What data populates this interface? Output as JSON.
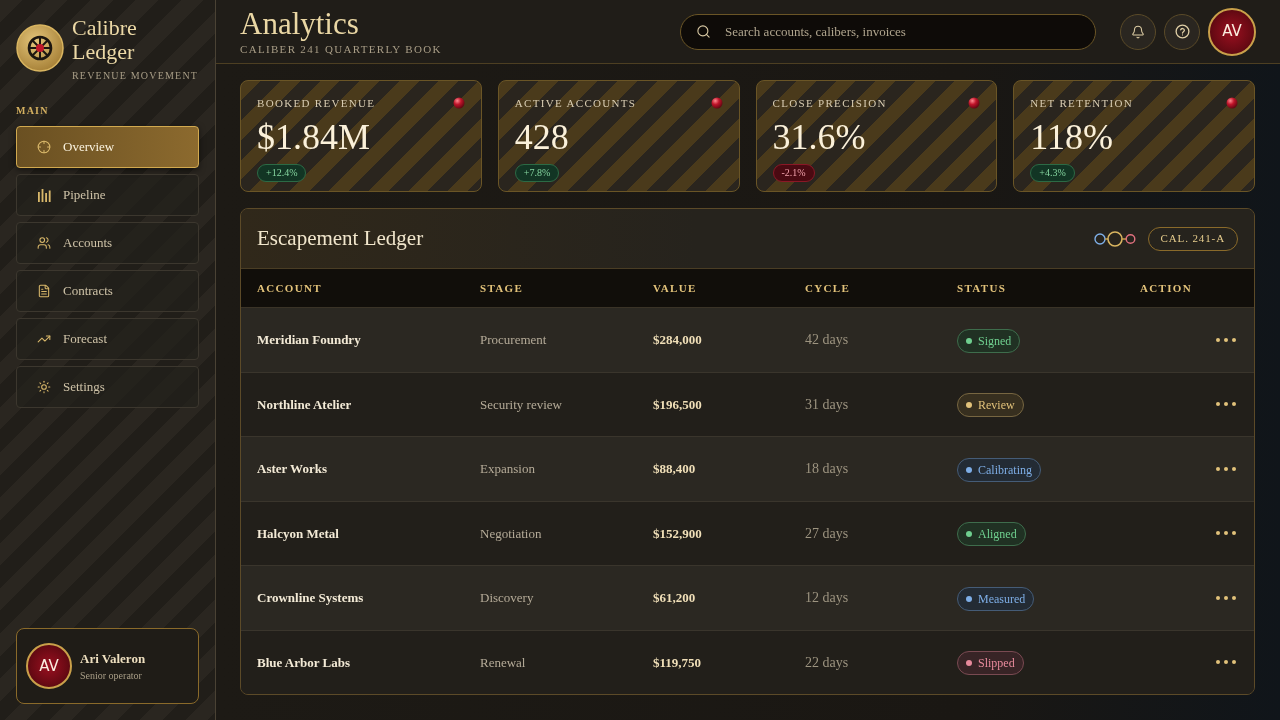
{
  "brand": {
    "name": "Calibre Ledger",
    "tagline": "REVENUE MOVEMENT"
  },
  "sidebar": {
    "section_label": "MAIN",
    "items": [
      {
        "label": "Overview",
        "selected": true
      },
      {
        "label": "Pipeline",
        "selected": false
      },
      {
        "label": "Accounts",
        "selected": false
      },
      {
        "label": "Contracts",
        "selected": false
      },
      {
        "label": "Forecast",
        "selected": false
      },
      {
        "label": "Settings",
        "selected": false
      }
    ]
  },
  "user": {
    "initials": "AV",
    "name": "Ari Valeron",
    "role": "Senior operator"
  },
  "header": {
    "title": "Analytics",
    "subtitle": "CALIBER 241 QUARTERLY BOOK",
    "search": {
      "placeholder": "Search accounts, calibers, invoices"
    },
    "avatar": "AV"
  },
  "cards": [
    {
      "label": "BOOKED REVENUE",
      "value": "$1.84M",
      "delta": "+12.4%",
      "positive": true
    },
    {
      "label": "ACTIVE ACCOUNTS",
      "value": "428",
      "delta": "+7.8%",
      "positive": true
    },
    {
      "label": "CLOSE PRECISION",
      "value": "31.6%",
      "delta": "-2.1%",
      "positive": false
    },
    {
      "label": "NET RETENTION",
      "value": "118%",
      "delta": "+4.3%",
      "positive": true
    }
  ],
  "table": {
    "title": "Escapement Ledger",
    "badge": "CAL. 241-A",
    "columns": [
      "ACCOUNT",
      "STAGE",
      "VALUE",
      "CYCLE",
      "STATUS",
      "ACTION"
    ],
    "rows": [
      {
        "account": "Meridian Foundry",
        "stage": "Procurement",
        "value": "$284,000",
        "cycle": "42 days",
        "status": {
          "label": "Signed",
          "color": "#6fcf8f"
        }
      },
      {
        "account": "Northline Atelier",
        "stage": "Security review",
        "value": "$196,500",
        "cycle": "31 days",
        "status": {
          "label": "Review",
          "color": "#e2c27a"
        }
      },
      {
        "account": "Aster Works",
        "stage": "Expansion",
        "value": "$88,400",
        "cycle": "18 days",
        "status": {
          "label": "Calibrating",
          "color": "#7eaee6"
        }
      },
      {
        "account": "Halcyon Metal",
        "stage": "Negotiation",
        "value": "$152,900",
        "cycle": "27 days",
        "status": {
          "label": "Aligned",
          "color": "#6fcf8f"
        }
      },
      {
        "account": "Crownline Systems",
        "stage": "Discovery",
        "value": "$61,200",
        "cycle": "12 days",
        "status": {
          "label": "Measured",
          "color": "#7eaee6"
        }
      },
      {
        "account": "Blue Arbor Labs",
        "stage": "Renewal",
        "value": "$119,750",
        "cycle": "22 days",
        "status": {
          "label": "Slipped",
          "color": "#e88a9c"
        }
      }
    ]
  }
}
